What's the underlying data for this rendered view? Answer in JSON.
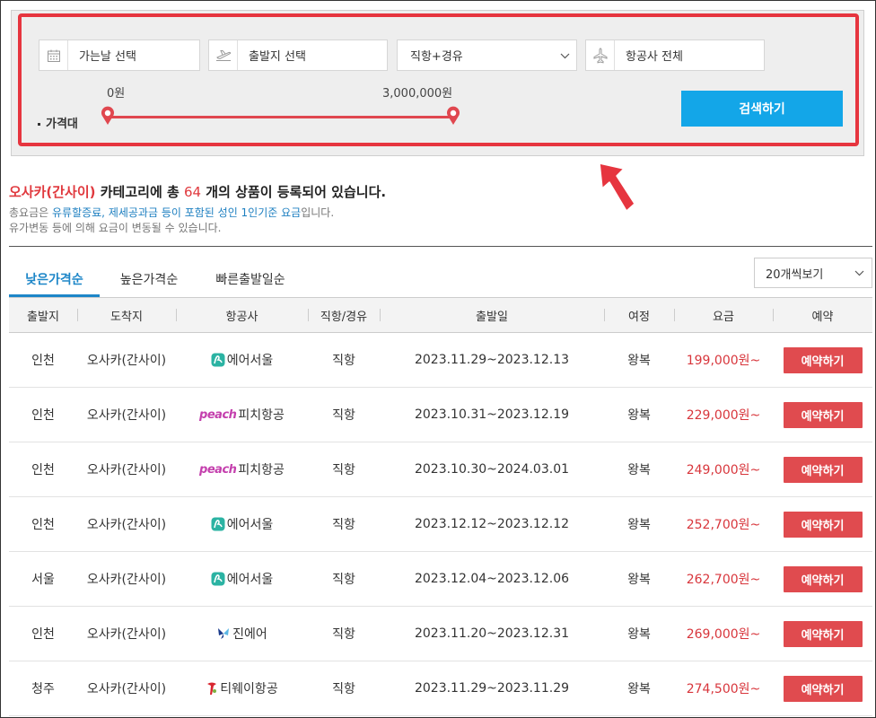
{
  "search": {
    "date_placeholder": "가는날 선택",
    "departure_placeholder": "출발지 선택",
    "route_selected": "직항+경유",
    "airline_selected": "항공사 전체",
    "price_min": "0원",
    "price_max": "3,000,000원",
    "price_label": "가격대",
    "search_button": "검색하기",
    "highlight_color": "#e6353f"
  },
  "info": {
    "category": "오사카(간사이)",
    "text_a": " 카테고리에 총 ",
    "count": "64",
    "text_b": " 개의 상품이 등록되어 있습니다.",
    "sub1_a": "총요금은 ",
    "sub1_b": "유류할증료, 제세공과금 등이 포함된 성인 1인기준 요금",
    "sub1_c": "입니다.",
    "sub2": "유가변동 등에 의해 요금이 변동될 수 있습니다."
  },
  "tabs": [
    {
      "label": "낮은가격순",
      "active": true
    },
    {
      "label": "높은가격순",
      "active": false
    },
    {
      "label": "빠른출발일순",
      "active": false
    }
  ],
  "per_page": "20개씩보기",
  "table": {
    "headers": [
      "출발지",
      "도착지",
      "항공사",
      "직항/경유",
      "출발일",
      "여정",
      "요금",
      "예약"
    ],
    "book_label": "예약하기",
    "rows": [
      {
        "dep": "인천",
        "arr": "오사카(간사이)",
        "airline": "에어서울",
        "logo": "airseoul",
        "route": "직항",
        "date": "2023.11.29~2023.12.13",
        "trip": "왕복",
        "price": "199,000원~"
      },
      {
        "dep": "인천",
        "arr": "오사카(간사이)",
        "airline": "피치항공",
        "logo": "peach",
        "route": "직항",
        "date": "2023.10.31~2023.12.19",
        "trip": "왕복",
        "price": "229,000원~"
      },
      {
        "dep": "인천",
        "arr": "오사카(간사이)",
        "airline": "피치항공",
        "logo": "peach",
        "route": "직항",
        "date": "2023.10.30~2024.03.01",
        "trip": "왕복",
        "price": "249,000원~"
      },
      {
        "dep": "인천",
        "arr": "오사카(간사이)",
        "airline": "에어서울",
        "logo": "airseoul",
        "route": "직항",
        "date": "2023.12.12~2023.12.12",
        "trip": "왕복",
        "price": "252,700원~"
      },
      {
        "dep": "서울",
        "arr": "오사카(간사이)",
        "airline": "에어서울",
        "logo": "airseoul",
        "route": "직항",
        "date": "2023.12.04~2023.12.06",
        "trip": "왕복",
        "price": "262,700원~"
      },
      {
        "dep": "인천",
        "arr": "오사카(간사이)",
        "airline": "진에어",
        "logo": "jinair",
        "route": "직항",
        "date": "2023.11.20~2023.12.31",
        "trip": "왕복",
        "price": "269,000원~"
      },
      {
        "dep": "청주",
        "arr": "오사카(간사이)",
        "airline": "티웨이항공",
        "logo": "tway",
        "route": "직항",
        "date": "2023.11.29~2023.11.29",
        "trip": "왕복",
        "price": "274,500원~"
      }
    ]
  },
  "logo_texts": {
    "peach": "peach"
  }
}
